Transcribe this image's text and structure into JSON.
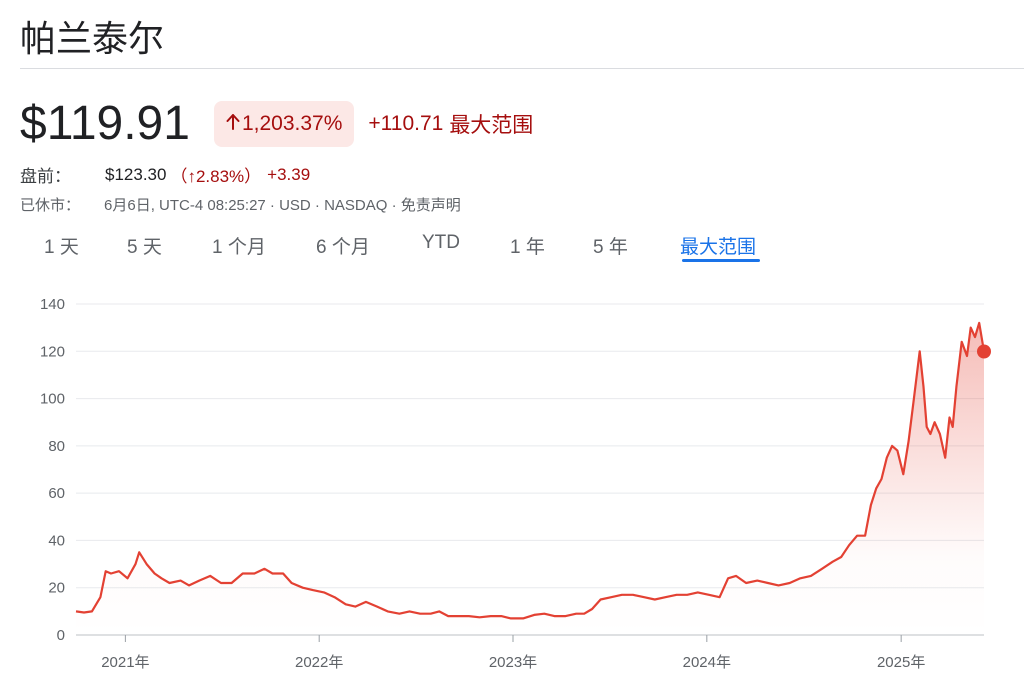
{
  "header": {
    "company_name": "帕兰泰尔"
  },
  "quote": {
    "price": "$119.91",
    "arrow_icon": "arrow-up-icon",
    "change_percent": "1,203.37%",
    "change_absolute": "+110.71",
    "period_label": "最大范围"
  },
  "premarket": {
    "label": "盘前：",
    "price": "$123.30",
    "change_percent": "（↑2.83%）",
    "change_absolute": "+3.39"
  },
  "status": {
    "label": "已休市：",
    "info": "6月6日, UTC-4 08:25:27 · USD · NASDAQ · 免责声明"
  },
  "tabs": [
    {
      "label": "1 天"
    },
    {
      "label": "5 天"
    },
    {
      "label": "1 个月"
    },
    {
      "label": "6 个月"
    },
    {
      "label": "YTD"
    },
    {
      "label": "1 年"
    },
    {
      "label": "5 年"
    },
    {
      "label": "最大范围",
      "active": true
    }
  ],
  "colors": {
    "line": "#e34133",
    "negative_text": "#a50e0e",
    "negative_bg": "#fce8e6",
    "active_tab": "#1a73e8"
  },
  "chart_data": {
    "type": "area",
    "title": "",
    "xlabel": "",
    "ylabel": "",
    "ylim": [
      0,
      140
    ],
    "xlim": [
      "2020-09-30",
      "2025-06-06"
    ],
    "yticks": [
      "0",
      "20",
      "40",
      "60",
      "80",
      "100",
      "120",
      "140"
    ],
    "xticks": [
      {
        "label": "2021年",
        "x": "2021-01-01"
      },
      {
        "label": "2022年",
        "x": "2022-01-01"
      },
      {
        "label": "2023年",
        "x": "2023-01-01"
      },
      {
        "label": "2024年",
        "x": "2024-01-01"
      },
      {
        "label": "2025年",
        "x": "2025-01-01"
      }
    ],
    "grid": true,
    "series": [
      {
        "x": [
          "2020-09-30",
          "2020-10-15",
          "2020-10-30",
          "2020-11-15",
          "2020-11-25",
          "2020-12-05",
          "2020-12-20",
          "2021-01-05",
          "2021-01-20",
          "2021-01-27",
          "2021-02-10",
          "2021-02-25",
          "2021-03-10",
          "2021-03-25",
          "2021-04-15",
          "2021-05-01",
          "2021-05-20",
          "2021-06-10",
          "2021-06-30",
          "2021-07-20",
          "2021-08-10",
          "2021-09-01",
          "2021-09-20",
          "2021-10-05",
          "2021-10-25",
          "2021-11-10",
          "2021-12-01",
          "2021-12-20",
          "2022-01-10",
          "2022-01-30",
          "2022-02-20",
          "2022-03-10",
          "2022-03-30",
          "2022-04-20",
          "2022-05-10",
          "2022-06-01",
          "2022-06-20",
          "2022-07-10",
          "2022-07-30",
          "2022-08-15",
          "2022-09-01",
          "2022-09-20",
          "2022-10-10",
          "2022-10-30",
          "2022-11-20",
          "2022-12-10",
          "2022-12-28",
          "2023-01-20",
          "2023-02-10",
          "2023-03-01",
          "2023-03-20",
          "2023-04-10",
          "2023-04-30",
          "2023-05-15",
          "2023-05-30",
          "2023-06-15",
          "2023-07-05",
          "2023-07-25",
          "2023-08-15",
          "2023-09-05",
          "2023-09-25",
          "2023-10-15",
          "2023-11-05",
          "2023-11-25",
          "2023-12-15",
          "2024-01-05",
          "2024-01-25",
          "2024-02-10",
          "2024-02-25",
          "2024-03-15",
          "2024-04-05",
          "2024-04-25",
          "2024-05-15",
          "2024-06-05",
          "2024-06-25",
          "2024-07-15",
          "2024-08-05",
          "2024-08-25",
          "2024-09-10",
          "2024-09-25",
          "2024-10-10",
          "2024-10-25",
          "2024-11-05",
          "2024-11-15",
          "2024-11-25",
          "2024-12-05",
          "2024-12-15",
          "2024-12-25",
          "2025-01-05",
          "2025-01-15",
          "2025-01-25",
          "2025-02-05",
          "2025-02-12",
          "2025-02-18",
          "2025-02-25",
          "2025-03-05",
          "2025-03-15",
          "2025-03-25",
          "2025-04-02",
          "2025-04-08",
          "2025-04-15",
          "2025-04-25",
          "2025-05-05",
          "2025-05-12",
          "2025-05-20",
          "2025-05-28",
          "2025-06-06"
        ],
        "y": [
          10,
          9.5,
          10,
          16,
          27,
          26,
          27,
          24,
          30,
          35,
          30,
          26,
          24,
          22,
          23,
          21,
          23,
          25,
          22,
          22,
          26,
          26,
          28,
          26,
          26,
          22,
          20,
          19,
          18,
          16,
          13,
          12,
          14,
          12,
          10,
          9,
          10,
          9,
          9,
          10,
          8,
          8,
          8,
          7.5,
          8,
          8,
          7,
          7,
          8.5,
          9,
          8,
          8,
          9,
          9,
          11,
          15,
          16,
          17,
          17,
          16,
          15,
          16,
          17,
          17,
          18,
          17,
          16,
          24,
          25,
          22,
          23,
          22,
          21,
          22,
          24,
          25,
          28,
          31,
          33,
          38,
          42,
          42,
          55,
          62,
          66,
          75,
          80,
          78,
          68,
          82,
          100,
          120,
          105,
          88,
          85,
          90,
          85,
          75,
          92,
          88,
          105,
          124,
          118,
          130,
          126,
          132,
          119.91
        ]
      }
    ]
  }
}
